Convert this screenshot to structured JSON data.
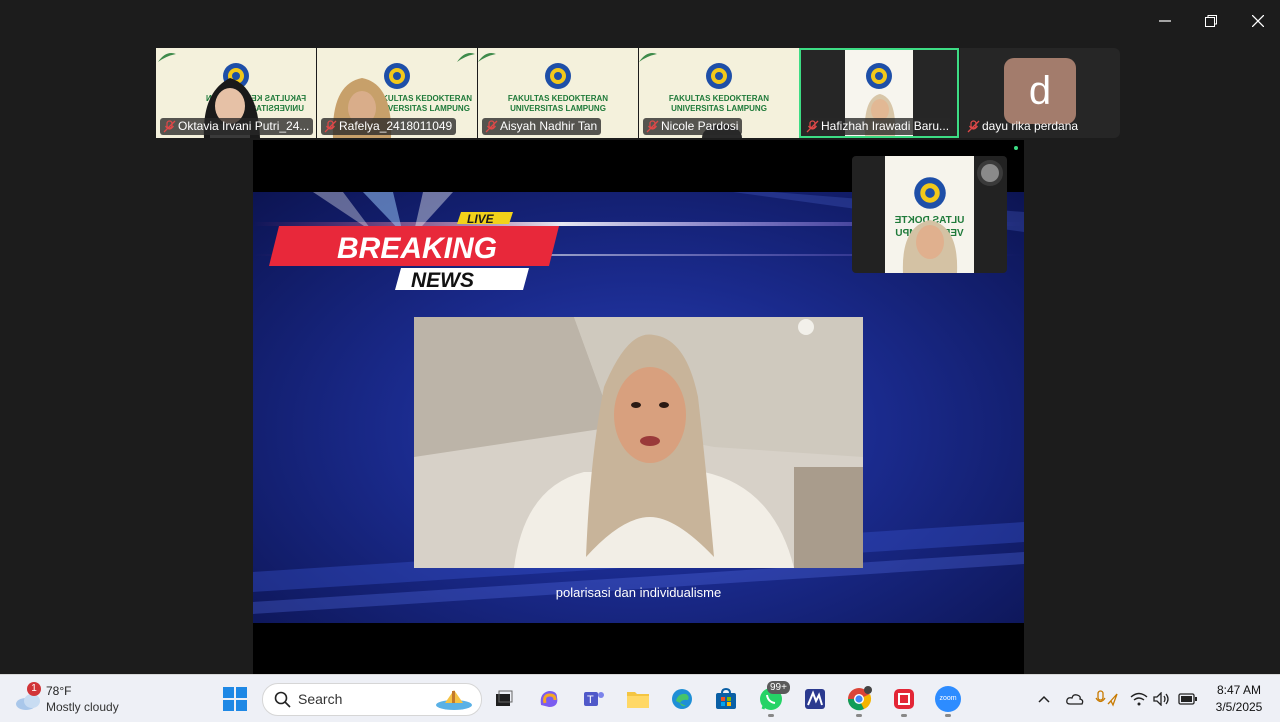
{
  "window": {
    "controls": [
      "minimize",
      "restore",
      "close"
    ]
  },
  "faculty": {
    "line1": "FAKULTAS KEDOKTERAN",
    "line2": "UNIVERSITAS LAMPUNG",
    "mirrored": "FAKULTAS KEDOKTERAN UNIVERSITAS LAMPUNG"
  },
  "participants": [
    {
      "name": "Oktavia Irvani Putri_24...",
      "muted": true
    },
    {
      "name": "Rafelya_2418011049",
      "muted": true
    },
    {
      "name": "Aisyah Nadhir Tan",
      "muted": true
    },
    {
      "name": "Nicole Pardosi",
      "muted": true
    },
    {
      "name": "Hafizhah Irawadi Baru...",
      "muted": true,
      "active": true
    },
    {
      "name": "dayu rika perdana",
      "muted": true,
      "avatar_letter": "d",
      "avatar_color": "#a37c6c"
    }
  ],
  "share": {
    "live_label": "LIVE",
    "breaking": "BREAKING",
    "news": "NEWS",
    "caption": "polarisasi dan individualisme"
  },
  "selfview": {
    "tiles": [
      "ULTAS DOKTE",
      "VERSI LAMPU"
    ]
  },
  "taskbar": {
    "weather": {
      "temp": "78°F",
      "cond": "Mostly cloudy",
      "badge": "1"
    },
    "search_placeholder": "Search",
    "whatsapp_badge": "99+",
    "zoom_label": "zoom",
    "time": "8:47 AM",
    "date": "3/5/2025"
  },
  "colors": {
    "active_border": "#3ddc84",
    "breaking_red": "#e8283a",
    "taskbar_bg": "#eef0f6"
  }
}
